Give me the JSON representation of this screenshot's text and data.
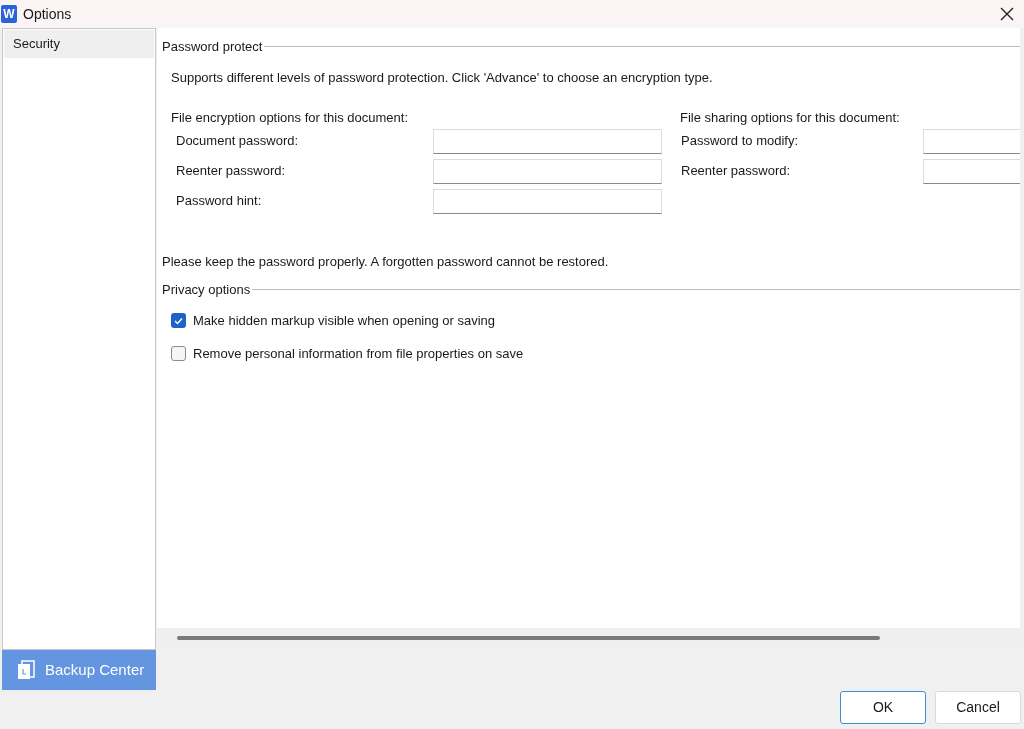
{
  "window": {
    "app_icon": "W",
    "title": "Options"
  },
  "sidebar": {
    "items": [
      {
        "label": "Security",
        "selected": true
      }
    ],
    "backup_button": "Backup Center"
  },
  "password_protect": {
    "heading": "Password protect",
    "description": "Supports different levels of password protection. Click 'Advance' to choose an encryption type.",
    "encryption": {
      "heading": "File encryption options for this document:",
      "fields": [
        {
          "label": "Document password:"
        },
        {
          "label": "Reenter password:"
        },
        {
          "label": "Password hint:"
        }
      ]
    },
    "sharing": {
      "heading": "File sharing options for this document:",
      "fields": [
        {
          "label": "Password to modify:"
        },
        {
          "label": "Reenter password:"
        }
      ]
    },
    "note": "Please keep the password properly. A forgotten password cannot be restored."
  },
  "privacy": {
    "heading": "Privacy options",
    "options": [
      {
        "label": "Make hidden markup visible when opening or saving",
        "checked": true
      },
      {
        "label": "Remove personal information from file properties on save",
        "checked": false
      }
    ]
  },
  "buttons": [
    {
      "label": "OK",
      "default": true
    },
    {
      "label": "Cancel",
      "default": false
    }
  ]
}
